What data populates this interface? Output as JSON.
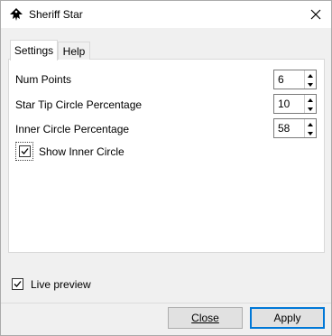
{
  "window": {
    "title": "Sheriff Star"
  },
  "tabs": [
    {
      "label": "Settings"
    },
    {
      "label": "Help"
    }
  ],
  "settings": {
    "rows": [
      {
        "label": "Num Points",
        "value": "6"
      },
      {
        "label": "Star Tip Circle Percentage",
        "value": "10"
      },
      {
        "label": "Inner Circle Percentage",
        "value": "58"
      }
    ],
    "show_inner_circle": {
      "label": "Show Inner Circle",
      "checked": true
    }
  },
  "live_preview": {
    "label": "Live preview",
    "checked": true
  },
  "buttons": {
    "close": "Close",
    "apply": "Apply"
  },
  "icons": {
    "app": "inkscape-icon",
    "close": "close-icon",
    "check": "check-icon",
    "spin_up": "arrow-up-icon",
    "spin_down": "arrow-down-icon"
  }
}
